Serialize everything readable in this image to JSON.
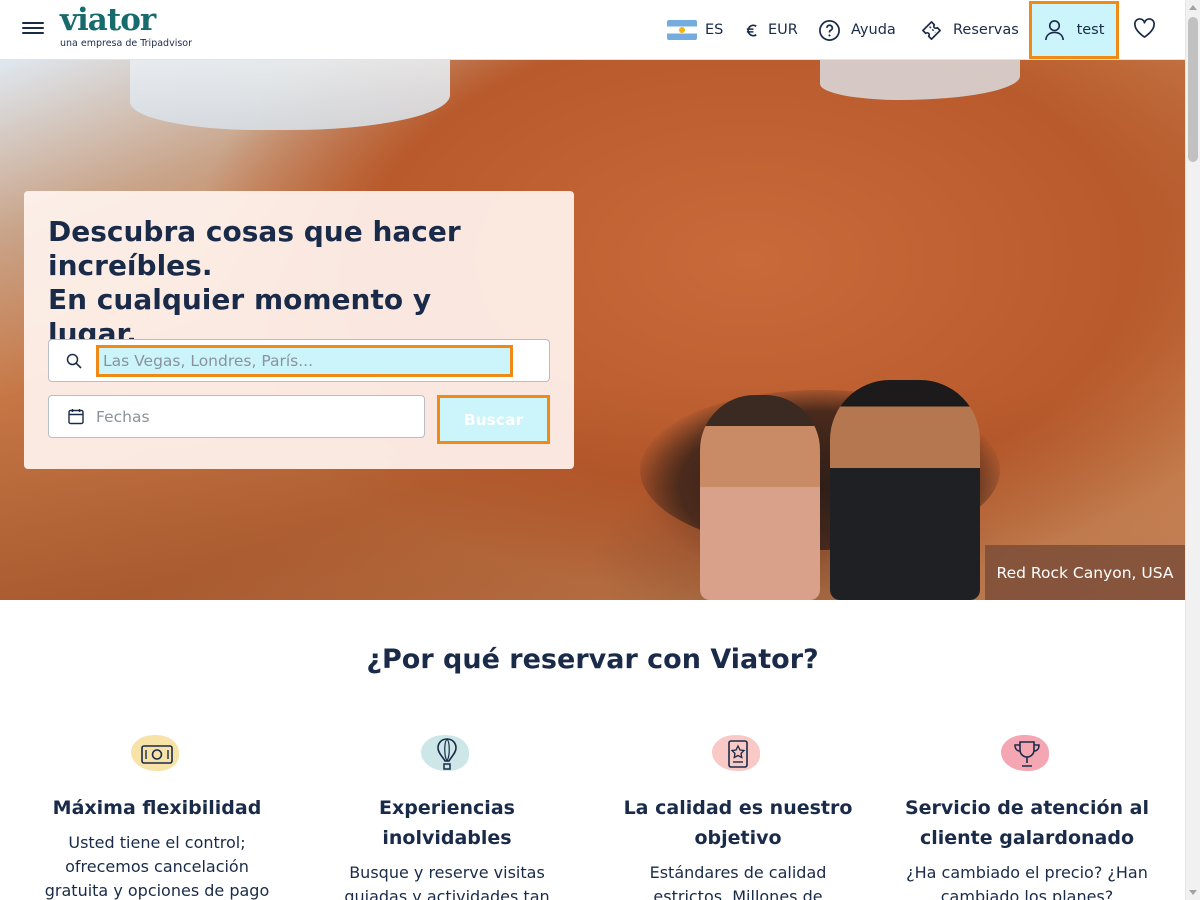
{
  "header": {
    "logo_text": "viator",
    "logo_tagline": "una empresa de Tripadvisor",
    "language": "ES",
    "currency": "EUR",
    "help": "Ayuda",
    "bookings": "Reservas",
    "profile": "test",
    "icons": [
      "menu-icon",
      "flag-argentina-icon",
      "euro-icon",
      "help-icon",
      "ticket-icon",
      "user-icon",
      "heart-icon"
    ]
  },
  "hero": {
    "title_line1": "Descubra cosas que hacer increíbles.",
    "title_line2": "En cualquier momento y lugar.",
    "search_placeholder": "Las Vegas, Londres, París...",
    "dates_placeholder": "Fechas",
    "search_button": "Buscar",
    "caption": "Red Rock Canyon, USA"
  },
  "why": {
    "title": "¿Por qué reservar con Viator?",
    "features": [
      {
        "title": "Máxima flexibilidad",
        "desc": "Usted tiene el control; ofrecemos cancelación gratuita y opciones de pago",
        "icon": "money-icon",
        "color": "#f7e2a8"
      },
      {
        "title": "Experiencias inolvidables",
        "desc": "Busque y reserve visitas guiadas y actividades tan",
        "icon": "balloon-icon",
        "color": "#cde7e8"
      },
      {
        "title": "La calidad es nuestro objetivo",
        "desc": "Estándares de calidad estrictos. Millones de",
        "icon": "badge-icon",
        "color": "#f8c9c5"
      },
      {
        "title": "Servicio de atención al cliente galardonado",
        "desc": "¿Ha cambiado el precio? ¿Han cambiado los planes?",
        "icon": "trophy-icon",
        "color": "#f4a7b3"
      }
    ]
  }
}
